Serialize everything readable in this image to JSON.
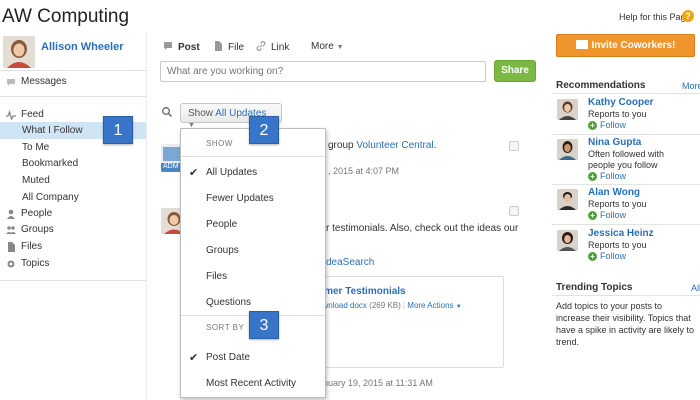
{
  "header": {
    "title": "AW Computing",
    "help": "Help for this Page",
    "help_icon": "?"
  },
  "sidebar": {
    "user_name": "Allison Wheeler",
    "messages": "Messages",
    "feed": "Feed",
    "feed_items": [
      "What I Follow",
      "To Me",
      "Bookmarked",
      "Muted",
      "All Company"
    ],
    "sections": [
      "People",
      "Groups",
      "Files",
      "Topics"
    ]
  },
  "publisher": {
    "tabs": [
      "Post",
      "File",
      "Link",
      "More"
    ],
    "placeholder": "What are you working on?",
    "share": "Share"
  },
  "filter": {
    "show_label": "Show",
    "show_value": "All Updates"
  },
  "dropdown": {
    "show_header": "SHOW",
    "show_items": [
      "All Updates",
      "Fewer Updates",
      "People",
      "Groups",
      "Files",
      "Questions"
    ],
    "sort_header": "SORT BY",
    "sort_items": [
      "Post Date",
      "Most Recent Activity"
    ],
    "check": "✔"
  },
  "feed": {
    "item1_text_pre": "group",
    "item1_group": "Volunteer Central",
    "item1_text_post": ".",
    "item1_badge": "ADM",
    "item1_meta": ", 2015 at 4:07 PM",
    "item2_line1": "r testimonials. Also, check out the ideas our",
    "item2_link": "deaSearch",
    "attach_title": "omer Testimonials",
    "attach_download": "ownload docx",
    "attach_size": "(269 KB)",
    "attach_more": "More Actions",
    "item2_meta": "anuary 19, 2015 at 11:31 AM"
  },
  "callouts": [
    "1",
    "2",
    "3"
  ],
  "right": {
    "invite": "Invite Coworkers!",
    "recommendations": "Recommendations",
    "more": "More",
    "people": [
      {
        "name": "Kathy Cooper",
        "desc": "Reports to you",
        "follow": "Follow"
      },
      {
        "name": "Nina Gupta",
        "desc": "Often followed with people you follow",
        "follow": "Follow"
      },
      {
        "name": "Alan Wong",
        "desc": "Reports to you",
        "follow": "Follow"
      },
      {
        "name": "Jessica Heinz",
        "desc": "Reports to you",
        "follow": "Follow"
      }
    ],
    "trending_title": "Trending Topics",
    "trending_all": "All",
    "trending_text": "Add topics to your posts to increase their visibility. Topics that have a spike in activity are likely to trend."
  },
  "colors": {
    "link": "#2a70b8",
    "share": "#7cb944",
    "invite": "#f0942c",
    "callout": "#3874c8",
    "selected": "#cfe4f4"
  }
}
